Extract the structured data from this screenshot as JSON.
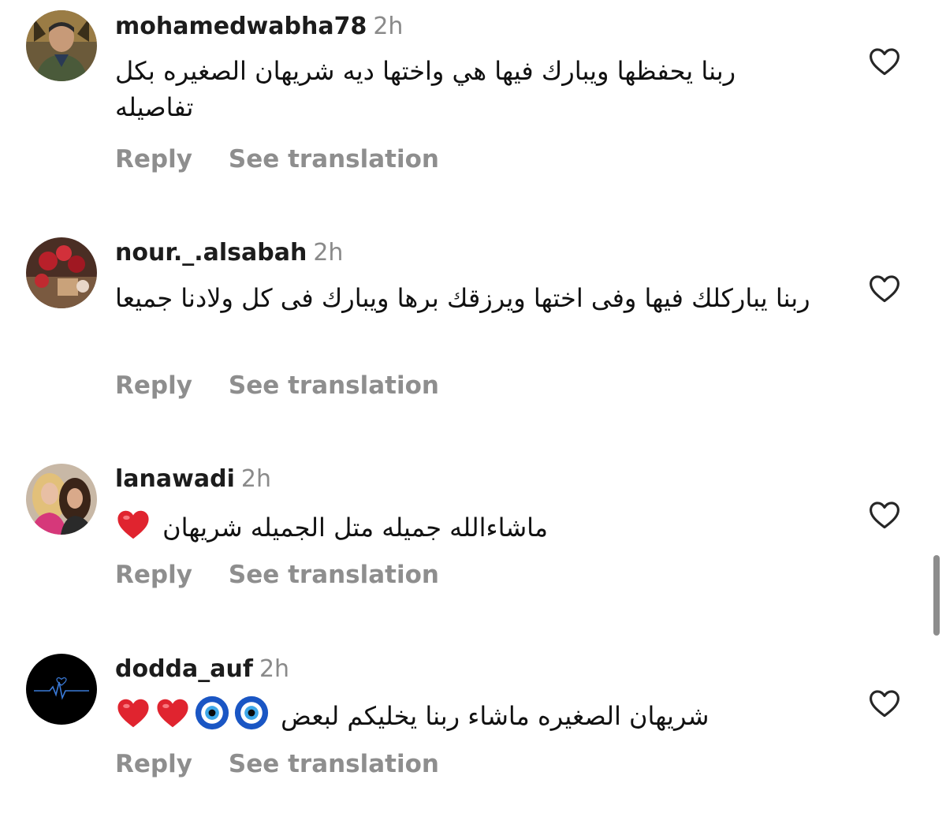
{
  "comments": [
    {
      "username": "mohamedwabha78",
      "time": "2h",
      "text": "ربنا يحفظها ويبارك فيها هي واختها ديه شريهان الصغيره بكل تفاصيله",
      "reply_label": "Reply",
      "translate_label": "See translation",
      "avatar_icon": "profile-photo-man",
      "like_icon": "heart-outline-icon"
    },
    {
      "username": "nour._.alsabah",
      "time": "2h",
      "text": "ربنا يباركلك فيها وفى اختها ويرزقك برها ويبارك فى كل ولادنا جميعا",
      "reply_label": "Reply",
      "translate_label": "See translation",
      "avatar_icon": "profile-photo-roses",
      "like_icon": "heart-outline-icon"
    },
    {
      "username": "lanawadi",
      "time": "2h",
      "text": "ماشاءالله جميله متل الجميله شريهان",
      "emojis": [
        "red-heart"
      ],
      "reply_label": "Reply",
      "translate_label": "See translation",
      "avatar_icon": "profile-photo-two-women",
      "like_icon": "heart-outline-icon"
    },
    {
      "username": "dodda_auf",
      "time": "2h",
      "text": "شريهان الصغيره ماشاء ربنا يخليكم لبعض",
      "emojis": [
        "nazar-amulet",
        "nazar-amulet",
        "red-heart",
        "red-heart"
      ],
      "reply_label": "Reply",
      "translate_label": "See translation",
      "avatar_icon": "profile-photo-heartbeat",
      "like_icon": "heart-outline-icon"
    }
  ],
  "colors": {
    "username": "#1c1c1c",
    "meta_gray": "#8e8e8e",
    "heart_red": "#e0242f",
    "nazar_blue": "#1a56c4"
  }
}
